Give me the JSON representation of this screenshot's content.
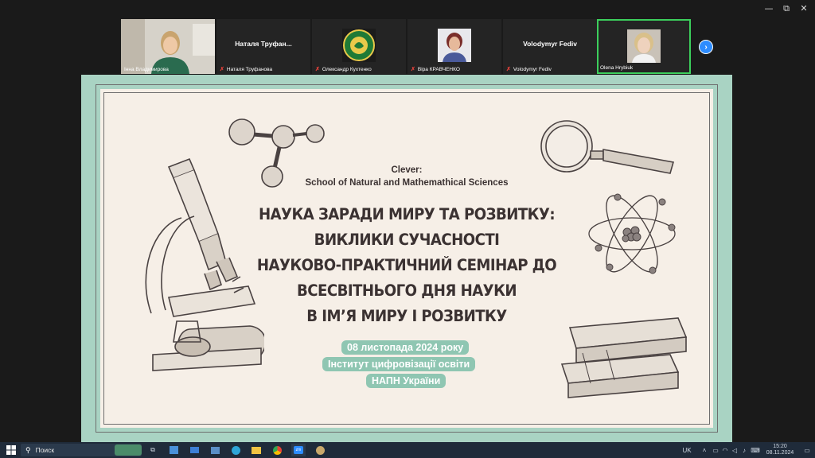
{
  "window": {
    "minimize": "—",
    "restore": "⧉",
    "close": "✕"
  },
  "participants": [
    {
      "name_overlay": "",
      "caption": "Інна Владимирова",
      "muted": false,
      "kind": "video"
    },
    {
      "name_overlay": "Наталя  Труфан...",
      "caption": "Наталя Труфанова",
      "muted": true,
      "kind": "name"
    },
    {
      "name_overlay": "",
      "caption": "Олександр Кухтенко",
      "muted": true,
      "kind": "logo"
    },
    {
      "name_overlay": "",
      "caption": "Віра КРАВЧЕНКО",
      "muted": true,
      "kind": "photo"
    },
    {
      "name_overlay": "Volodymyr Fediv",
      "caption": "Volodymyr Fediv",
      "muted": true,
      "kind": "name"
    },
    {
      "name_overlay": "",
      "caption": "Olena Hrybiuk",
      "muted": false,
      "kind": "photo",
      "active": true
    }
  ],
  "gallery_next": "›",
  "slide": {
    "brand": "Clever:",
    "school": "School of Natural and Mathemathical Sciences",
    "title_lines": [
      "НАУКА ЗАРАДИ МИРУ ТА РОЗВИТКУ:",
      "ВИКЛИКИ СУЧАСНОСТІ",
      "НАУКОВО-ПРАКТИЧНИЙ СЕМІНАР ДО",
      "ВСЕСВІТНЬОГО ДНЯ НАУКИ",
      "В ІМ’Я МИРУ І РОЗВИТКУ"
    ],
    "date": "08 листопада 2024 року",
    "institute": "Інститут цифровізації освіти",
    "academy": "НАПН України",
    "colors": {
      "border": "#a9d3c3",
      "paper": "#f6efe7",
      "pill": "#8fc6b2",
      "text": "#3b3232"
    }
  },
  "taskbar": {
    "search_placeholder": "Поиск",
    "lang": "UK",
    "time": "15:20",
    "date": "08.11.2024",
    "apps": [
      "task-view-icon",
      "store-icon",
      "mail-icon",
      "folder-icon",
      "edge-icon",
      "files-icon",
      "chrome-icon",
      "zoom-icon",
      "paint-icon"
    ]
  }
}
